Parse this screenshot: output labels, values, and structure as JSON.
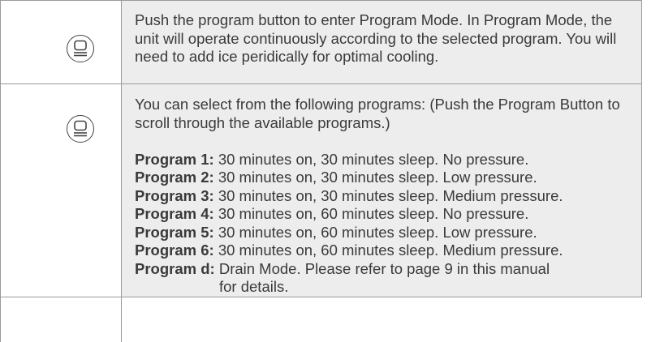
{
  "rows": [
    {
      "icon": "program-button-icon",
      "text": "Push the program button to enter Program Mode. In Program Mode, the unit will operate continuously according to the selected program. You will need to add ice peridically for optimal cooling."
    },
    {
      "icon": "program-button-icon",
      "intro": "You can select from the following programs: (Push the Program Button to scroll through the available programs.)",
      "programs": [
        {
          "label": "Program 1:",
          "desc": "30 minutes on, 30 minutes sleep. No pressure."
        },
        {
          "label": "Program 2:",
          "desc": "30 minutes on, 30 minutes sleep. Low pressure."
        },
        {
          "label": "Program 3:",
          "desc": "30 minutes on, 30 minutes sleep. Medium pressure."
        },
        {
          "label": "Program 4:",
          "desc": "30 minutes on, 60 minutes sleep. No pressure."
        },
        {
          "label": "Program 5:",
          "desc": "30 minutes on, 60 minutes sleep. Low pressure."
        },
        {
          "label": "Program 6:",
          "desc": "30 minutes on, 60 minutes sleep. Medium pressure."
        },
        {
          "label": "Program d:",
          "desc": "Drain Mode. Please refer to page 9 in this manual",
          "cont": "for details."
        }
      ]
    }
  ],
  "colors": {
    "cell_shade": "#ededed",
    "border": "#9a9a9a",
    "text": "#3a3a3a"
  }
}
